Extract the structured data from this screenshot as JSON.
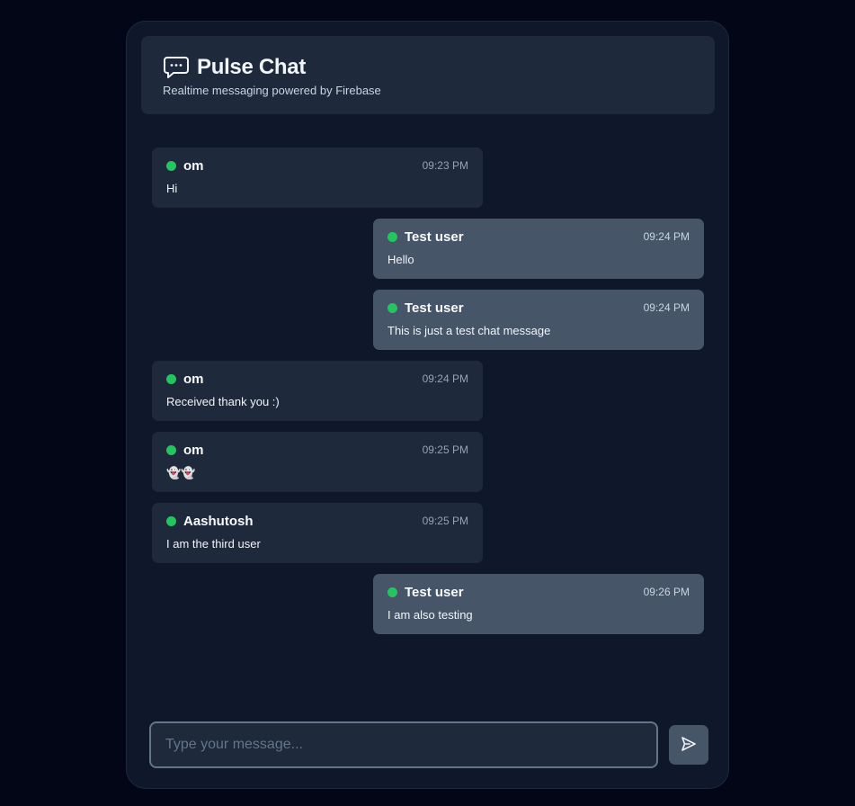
{
  "header": {
    "title": "Pulse Chat",
    "subtitle": "Realtime messaging powered by Firebase",
    "icon": "chat-bubble-icon"
  },
  "colors": {
    "background": "#020617",
    "panel": "#0f172a",
    "card": "#1e293b",
    "self_card": "#475569",
    "online": "#22c55e"
  },
  "messages": [
    {
      "author": "om",
      "time": "09:23 PM",
      "text": "Hi",
      "side": "other"
    },
    {
      "author": "Test user",
      "time": "09:24 PM",
      "text": "Hello",
      "side": "self"
    },
    {
      "author": "Test user",
      "time": "09:24 PM",
      "text": "This is just a test chat message",
      "side": "self"
    },
    {
      "author": "om",
      "time": "09:24 PM",
      "text": "Received thank you :)",
      "side": "other"
    },
    {
      "author": "om",
      "time": "09:25 PM",
      "text": "👻👻",
      "side": "other"
    },
    {
      "author": "Aashutosh",
      "time": "09:25 PM",
      "text": "I am the third user",
      "side": "other"
    },
    {
      "author": "Test user",
      "time": "09:26 PM",
      "text": "I am also testing",
      "side": "self"
    }
  ],
  "composer": {
    "placeholder": "Type your message...",
    "value": "",
    "send_icon": "send-icon"
  }
}
